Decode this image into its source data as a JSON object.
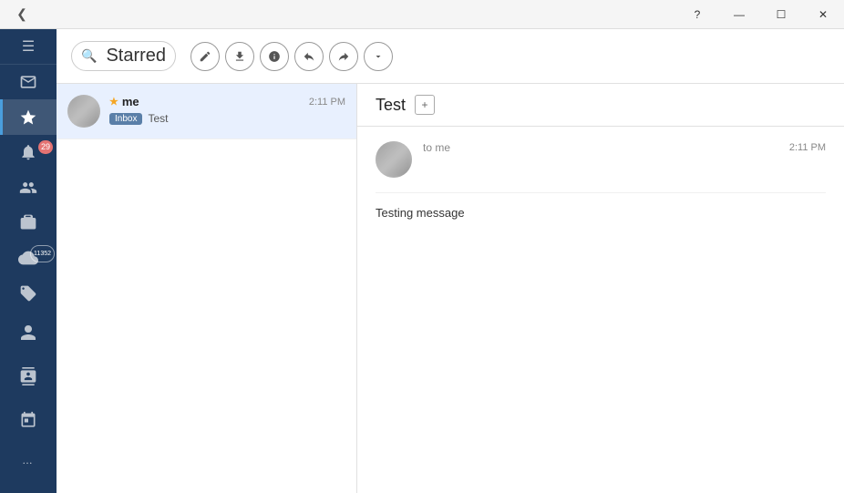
{
  "titleBar": {
    "backBtn": "❮",
    "helpBtn": "?",
    "minimizeBtn": "—",
    "maximizeBtn": "☐",
    "closeBtn": "✕"
  },
  "sidebar": {
    "menuIcon": "☰",
    "icons": [
      {
        "name": "inbox-icon",
        "symbol": "✉",
        "badge": null,
        "active": false
      },
      {
        "name": "starred-icon",
        "symbol": "★",
        "badge": null,
        "active": true
      },
      {
        "name": "notifications-icon",
        "symbol": "🔔",
        "badge": "29",
        "active": false
      },
      {
        "name": "contacts-icon",
        "symbol": "👤",
        "badge": null,
        "active": false
      },
      {
        "name": "briefcase-icon",
        "symbol": "💼",
        "badge": null,
        "active": false
      },
      {
        "name": "cloud-icon",
        "symbol": "☁",
        "badge": "11352",
        "badgeType": "blue",
        "active": false
      },
      {
        "name": "tags-icon",
        "symbol": "🏷",
        "badge": null,
        "active": false
      }
    ],
    "bottomIcons": [
      {
        "name": "person-icon",
        "symbol": "👤"
      },
      {
        "name": "address-book-icon",
        "symbol": "📇"
      },
      {
        "name": "calendar-icon",
        "symbol": "📅"
      },
      {
        "name": "more-icon",
        "symbol": "•••"
      }
    ]
  },
  "toolbar": {
    "searchPlaceholder": "Starred",
    "pageTitle": "Starred",
    "actions": [
      {
        "name": "compose-btn",
        "symbol": "✏",
        "title": "Compose"
      },
      {
        "name": "download-btn",
        "symbol": "↓",
        "title": "Download"
      },
      {
        "name": "info-btn",
        "symbol": "ℹ",
        "title": "Info"
      },
      {
        "name": "reply-btn",
        "symbol": "↩",
        "title": "Reply"
      },
      {
        "name": "forward-btn",
        "symbol": "↪",
        "title": "Forward"
      },
      {
        "name": "more-actions-btn",
        "symbol": "▾",
        "title": "More"
      }
    ]
  },
  "emailList": {
    "items": [
      {
        "id": "email-1",
        "sender": "me",
        "starred": true,
        "time": "2:11 PM",
        "label": "Inbox",
        "subject": "Test",
        "selected": true
      }
    ]
  },
  "emailDetail": {
    "title": "Test",
    "addTabLabel": "+",
    "message": {
      "to": "to me",
      "time": "2:11 PM",
      "body": "Testing message"
    }
  }
}
